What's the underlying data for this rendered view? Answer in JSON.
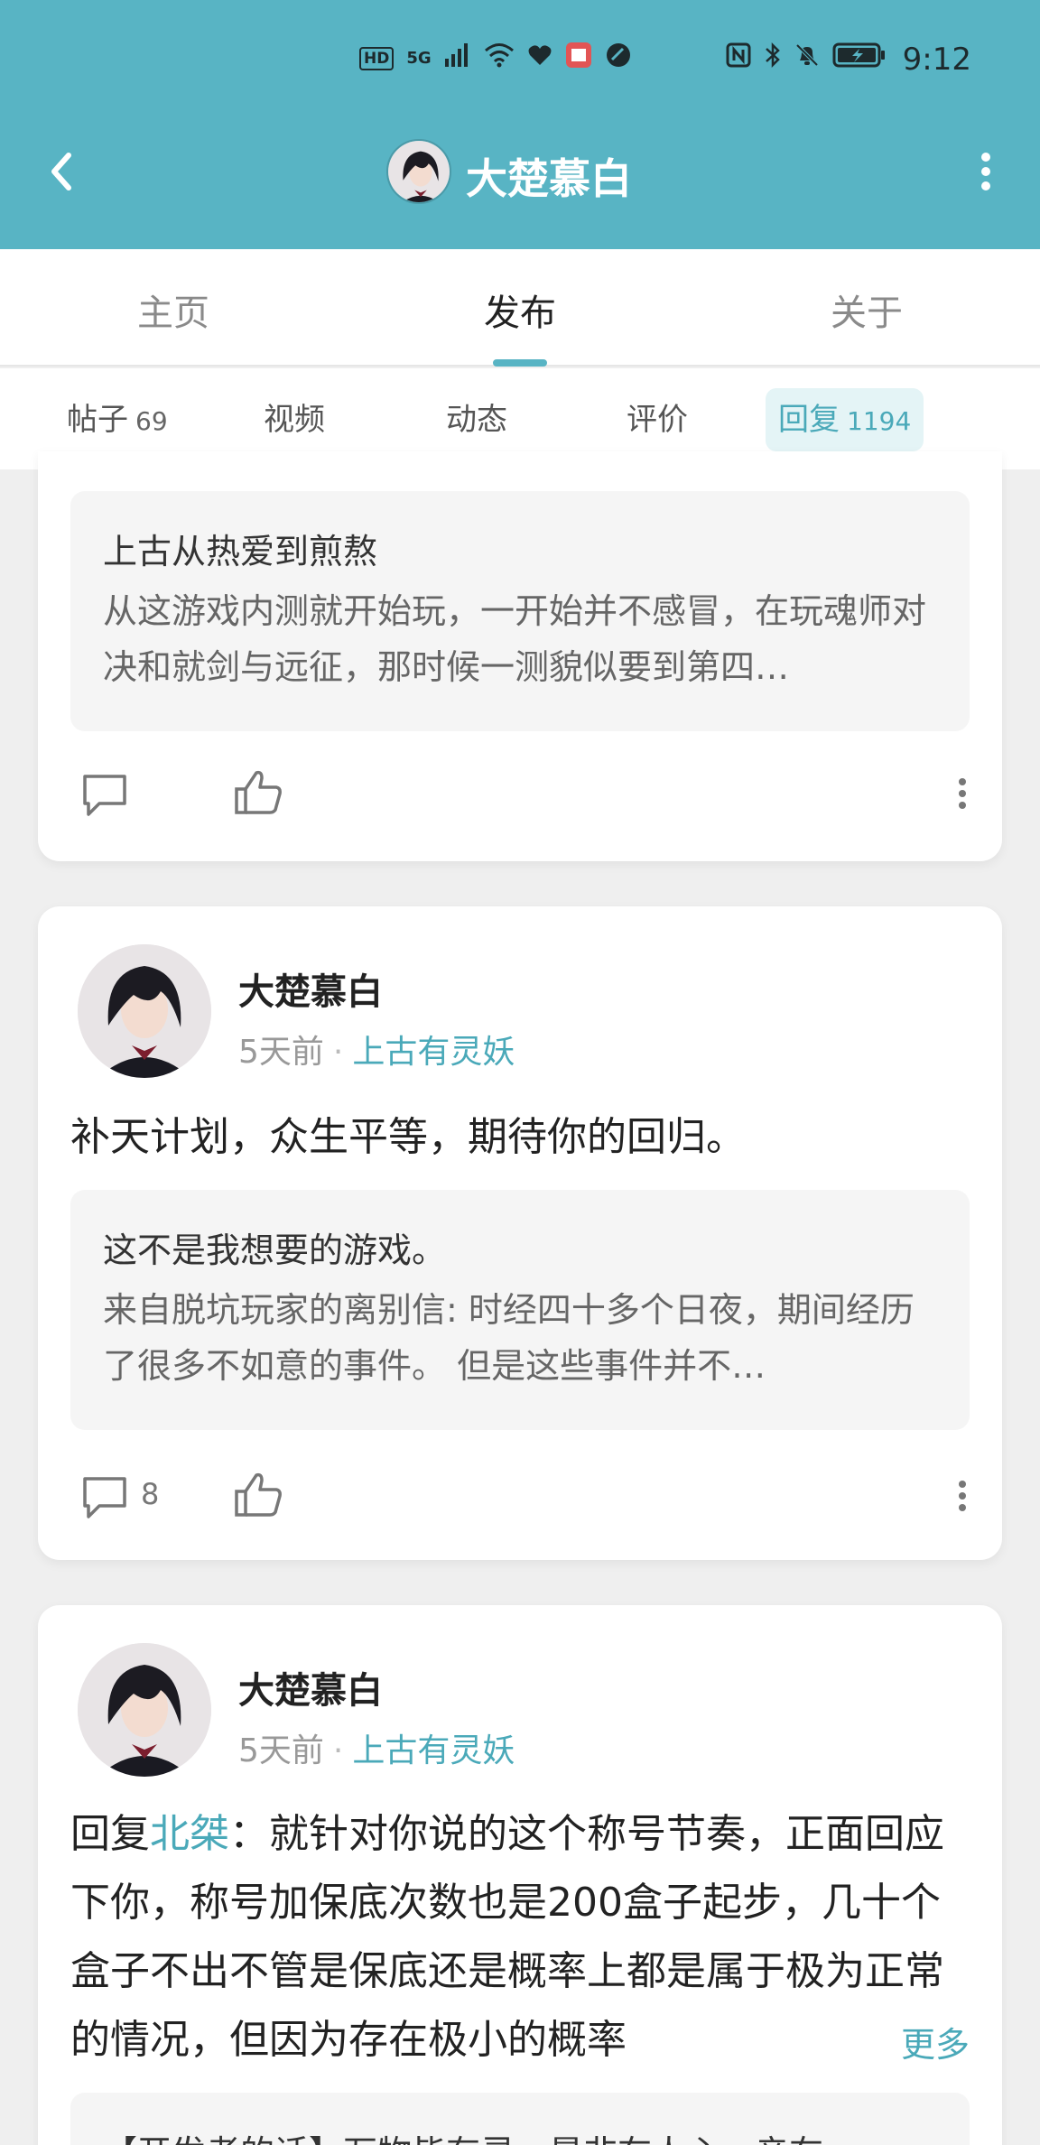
{
  "status_bar": {
    "left_badges": [
      "HD",
      "5G"
    ],
    "time": "9:12"
  },
  "header": {
    "title": "大楚慕白",
    "back_icon": "chevron-left-icon",
    "more_icon": "more-vertical-icon"
  },
  "tabs": [
    {
      "label": "主页",
      "active": false
    },
    {
      "label": "发布",
      "active": true
    },
    {
      "label": "关于",
      "active": false
    }
  ],
  "subtabs": [
    {
      "label": "帖子",
      "count": "69",
      "active": false
    },
    {
      "label": "视频",
      "count": "",
      "active": false
    },
    {
      "label": "动态",
      "count": "",
      "active": false
    },
    {
      "label": "评价",
      "count": "",
      "active": false
    },
    {
      "label": "回复",
      "count": "1194",
      "active": true
    }
  ],
  "posts": [
    {
      "quote_title": "上古从热爱到煎熬",
      "quote_body": "从这游戏内测就开始玩，一开始并不感冒，在玩魂师对决和就剑与远征，那时候一测貌似要到第四…",
      "comment_count": ""
    },
    {
      "author": "大楚慕白",
      "time": "5天前",
      "forum": "上古有灵妖",
      "text": "补天计划，众生平等，期待你的回归。",
      "quote_title": "这不是我想要的游戏。",
      "quote_body": "来自脱坑玩家的离别信: 时经四十多个日夜，期间经历了很多不如意的事件。   但是这些事件并不…",
      "comment_count": "8"
    },
    {
      "author": "大楚慕白",
      "time": "5天前",
      "forum": "上古有灵妖",
      "reply_prefix": "回复",
      "reply_user": "北桀",
      "text": "：就针对你说的这个称号节奏，正面回应下你，称号加保底次数也是200盒子起步，几十个盒子不出不管是保底还是概率上都是属于极为正常的情况，但因为存在极小的概率",
      "more_label": "更多",
      "quote_body": "【开发者的话】万物皆有灵，是非在人心。亲在"
    }
  ],
  "colors": {
    "accent": "#58b4c4",
    "link": "#4aa9b9",
    "background": "#efefef"
  }
}
